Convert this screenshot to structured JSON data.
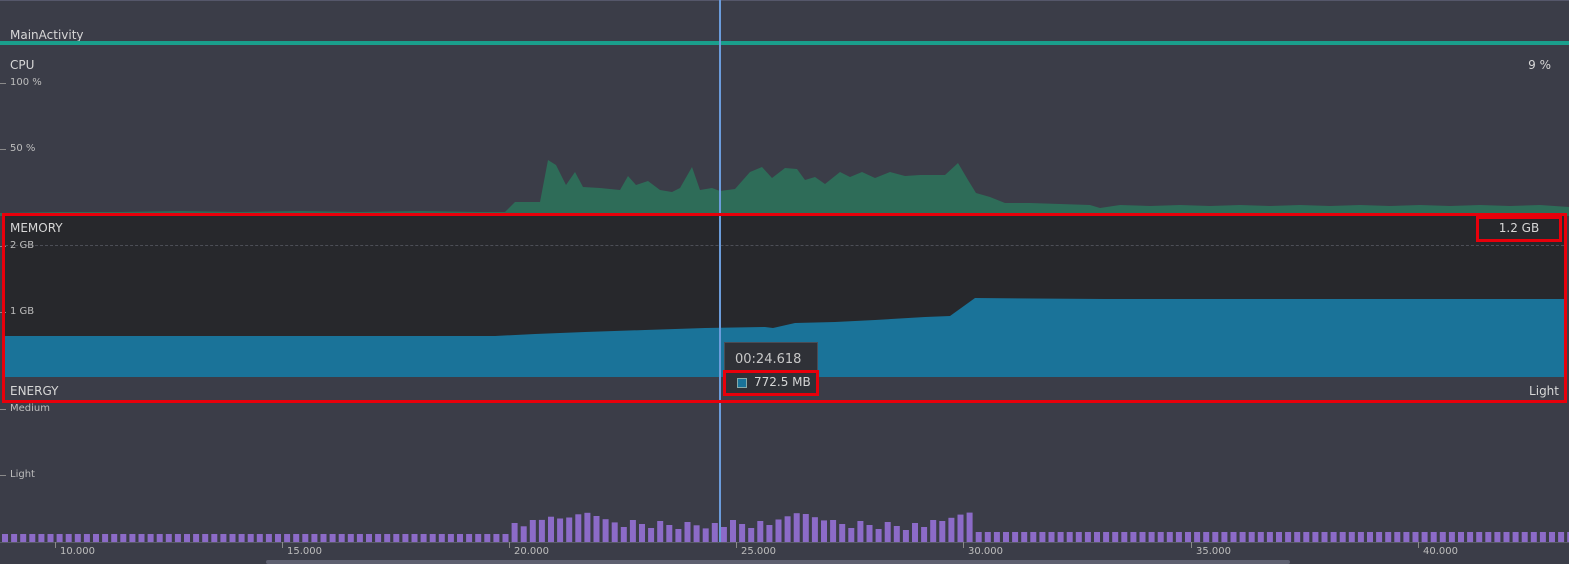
{
  "activity": {
    "label": "MainActivity"
  },
  "cpu": {
    "title": "CPU",
    "value": "9 %",
    "ticks": [
      "100 %",
      "50 %"
    ]
  },
  "memory": {
    "title": "MEMORY",
    "value": "1.2 GB",
    "ticks": [
      "2 GB",
      "1 GB"
    ]
  },
  "energy": {
    "title": "ENERGY",
    "value": "Light",
    "ticks": [
      "Medium",
      "Light"
    ]
  },
  "tooltip": {
    "time": "00:24.618",
    "value": "772.5 MB"
  },
  "timeline": {
    "ticks": [
      "10.000",
      "15.000",
      "20.000",
      "25.000",
      "30.000",
      "35.000",
      "40.000"
    ]
  },
  "colors": {
    "accent_line": "#1a9f8c",
    "cpu_fill": "#2e6c58",
    "memory_fill": "#1a7399",
    "memory_bg": "#27282c",
    "energy_bar": "#8c6bc8",
    "cursor": "#6b9cdb",
    "highlight": "#e8000b"
  }
}
